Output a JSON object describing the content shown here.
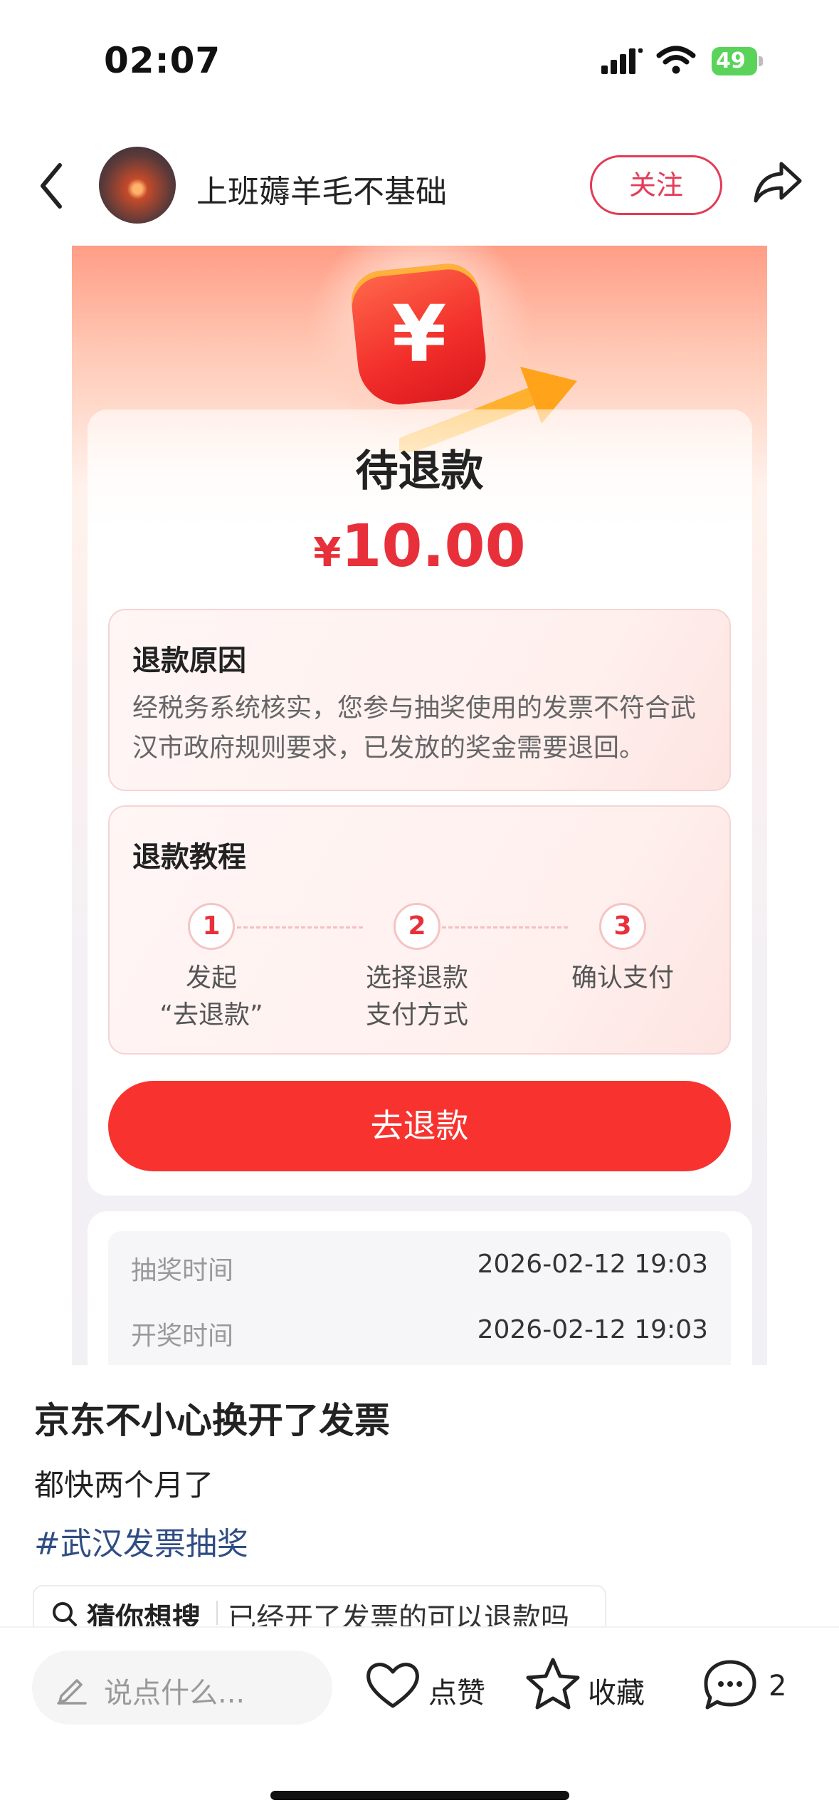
{
  "status_bar": {
    "time": "02:07",
    "battery": "49"
  },
  "header": {
    "username": "上班薅羊毛不基础",
    "follow_label": "关注"
  },
  "refund_card": {
    "coin_symbol": "¥",
    "status": "待退款",
    "currency": "¥",
    "amount": "10.00",
    "reason_title": "退款原因",
    "reason_line1": "经税务系统核实，您参与抽奖使用的发票不符合武",
    "reason_line2": "汉市政府规则要求，已发放的奖金需要退回。",
    "tutorial_title": "退款教程",
    "steps": [
      {
        "num": "1",
        "line1": "发起",
        "line2": "“去退款”"
      },
      {
        "num": "2",
        "line1": "选择退款",
        "line2": "支付方式"
      },
      {
        "num": "3",
        "line1": "确认支付",
        "line2": ""
      }
    ],
    "button": "去退款",
    "info": [
      {
        "label": "抽奖时间",
        "value": "2026-02-12 19:03"
      },
      {
        "label": "开奖时间",
        "value": "2026-02-12 19:03"
      }
    ]
  },
  "post": {
    "title": "京东不小心换开了发票",
    "body": "都快两个月了",
    "hashtag": "#武汉发票抽奖"
  },
  "suggest": {
    "label": "猜你想搜",
    "query": "已经开了发票的可以退款吗"
  },
  "bottom_bar": {
    "comment_placeholder": "说点什么...",
    "like_label": "点赞",
    "collect_label": "收藏",
    "comment_count": "2"
  }
}
